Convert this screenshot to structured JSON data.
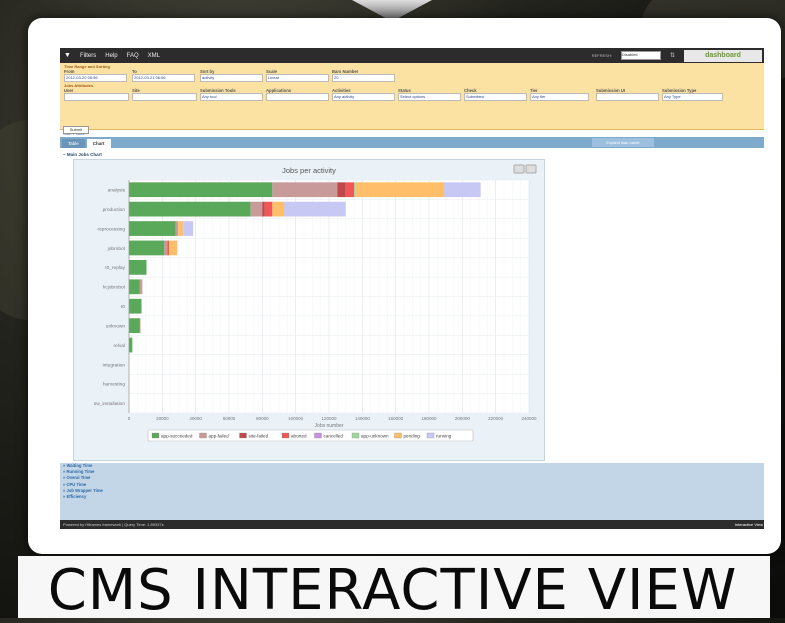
{
  "topbar": {
    "menu": [
      "Filters",
      "Help",
      "FAQ",
      "XML"
    ],
    "refresh_label": "REFRESH:",
    "refresh_value": "Disabled",
    "logo_text": "dashboard"
  },
  "filters": {
    "section_time": "Time Range and Sorting",
    "section_job": "Jobs Attributes",
    "from_label": "From",
    "from_value": "2012-03-20 06:56",
    "to_label": "To",
    "to_value": "2012-03-21 06:56",
    "sortby_label": "Sort by",
    "sortby_value": "activity",
    "scale_label": "Scale",
    "scale_value": "Linear",
    "bars_label": "Bars Number",
    "bars_value": "20",
    "user_label": "User",
    "site_label": "Site",
    "subtools_label": "Submission Tools",
    "subtools_value": "Any tool",
    "apps_label": "Applications",
    "activities_label": "Activities",
    "activities_value": "Any activity",
    "status_label": "Status",
    "status_value": "Select options",
    "check_label": "Check",
    "check_value": "Submitted",
    "tier_label": "Tier",
    "tier_value": "Any tier",
    "subui_label": "Submission UI",
    "subtype_label": "Submission Type",
    "subtype_value": "Any Type",
    "submit_label": "Submit"
  },
  "breadcrumb": "Start » Jobs",
  "tabs": [
    "Table",
    "Chart"
  ],
  "expand_label": "Expand task name",
  "main_chart_label": "− Main Jobs Chart",
  "chart_data": {
    "type": "bar",
    "orientation": "horizontal",
    "stacked": true,
    "title": "Jobs per activity",
    "xlabel": "Jobs number",
    "xlim": [
      0,
      240000
    ],
    "xticks": [
      "0",
      "20000",
      "40000",
      "60000",
      "80000",
      "100000",
      "120000",
      "140000",
      "160000",
      "180000",
      "200000",
      "220000",
      "240000"
    ],
    "categories": [
      "analysis",
      "production",
      "reprocessing",
      "jobrobot",
      "t0_replay",
      "hcjobrobot",
      "t0",
      "unknown",
      "relval",
      "integration",
      "harvesting",
      "sw_installation"
    ],
    "series": [
      {
        "name": "app-succeeded",
        "color": "#5aa85a",
        "values": [
          86000,
          73000,
          28000,
          21000,
          10500,
          6500,
          7500,
          6500,
          2000,
          0,
          0,
          0
        ]
      },
      {
        "name": "app-failed",
        "color": "#c89a9a",
        "values": [
          39000,
          7000,
          1500,
          2000,
          0,
          1500,
          0,
          0,
          0,
          0,
          0,
          0
        ]
      },
      {
        "name": "site-failed",
        "color": "#c04848",
        "values": [
          5000,
          1500,
          0,
          0,
          0,
          0,
          0,
          0,
          0,
          0,
          0,
          0
        ]
      },
      {
        "name": "aborted",
        "color": "#f05858",
        "values": [
          5000,
          4500,
          0,
          1000,
          0,
          0,
          0,
          300,
          0,
          0,
          0,
          0
        ]
      },
      {
        "name": "cancelled",
        "color": "#c890e0",
        "values": [
          0,
          0,
          0,
          0,
          0,
          0,
          0,
          0,
          0,
          0,
          0,
          0
        ]
      },
      {
        "name": "app-unknown",
        "color": "#9cd89c",
        "values": [
          1000,
          0,
          0,
          0,
          0,
          0,
          0,
          0,
          0,
          0,
          0,
          0
        ]
      },
      {
        "name": "pending",
        "color": "#ffbf6a",
        "values": [
          53000,
          7000,
          3000,
          5000,
          0,
          0,
          0,
          0,
          0,
          0,
          0,
          0
        ]
      },
      {
        "name": "running",
        "color": "#c8c8f5",
        "values": [
          22000,
          37000,
          6000,
          0,
          0,
          0,
          0,
          0,
          0,
          0,
          0,
          0
        ]
      }
    ],
    "grid": true,
    "legend": "bottom"
  },
  "lower_links": [
    "» Waiting Time",
    "» Running Time",
    "» Overal Time",
    "» CPU Time",
    "» Job Wrapper Time",
    "» Efficiency"
  ],
  "footer": {
    "left": "Powered by Hiframes framework  |  Query Time: 1.89337s",
    "right": "Interactive View"
  },
  "caption": "CMS INTERACTIVE VIEW"
}
